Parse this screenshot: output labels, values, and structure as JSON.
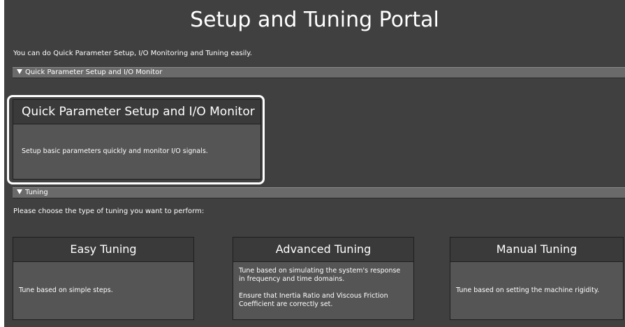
{
  "page": {
    "title": "Setup and Tuning Portal",
    "intro": "You can do Quick Parameter Setup, I/O Monitoring and Tuning easily."
  },
  "sections": {
    "quick_param": {
      "header": "Quick Parameter Setup and I/O Monitor",
      "tile_title": "Quick Parameter Setup and I/O Monitor",
      "tile_desc": "Setup basic parameters quickly and monitor I/O signals."
    },
    "tuning": {
      "header": "Tuning",
      "prompt": "Please choose the type of tuning you want to perform:",
      "tiles": [
        {
          "title": "Easy Tuning",
          "desc": "Tune based on simple steps."
        },
        {
          "title": "Advanced Tuning",
          "desc_lines": [
            "Tune based on simulating the system's response in frequency and time domains.",
            "Ensure that Inertia Ratio and Viscous Friction Coefficient are correctly set."
          ]
        },
        {
          "title": "Manual Tuning",
          "desc": "Tune based on setting the machine rigidity."
        }
      ]
    }
  },
  "colors": {
    "background": "#404040",
    "tile_header": "#3a3a3a",
    "tile_body": "#555555",
    "section_bar": "#6a6a6a",
    "highlight": "#ffffff"
  }
}
